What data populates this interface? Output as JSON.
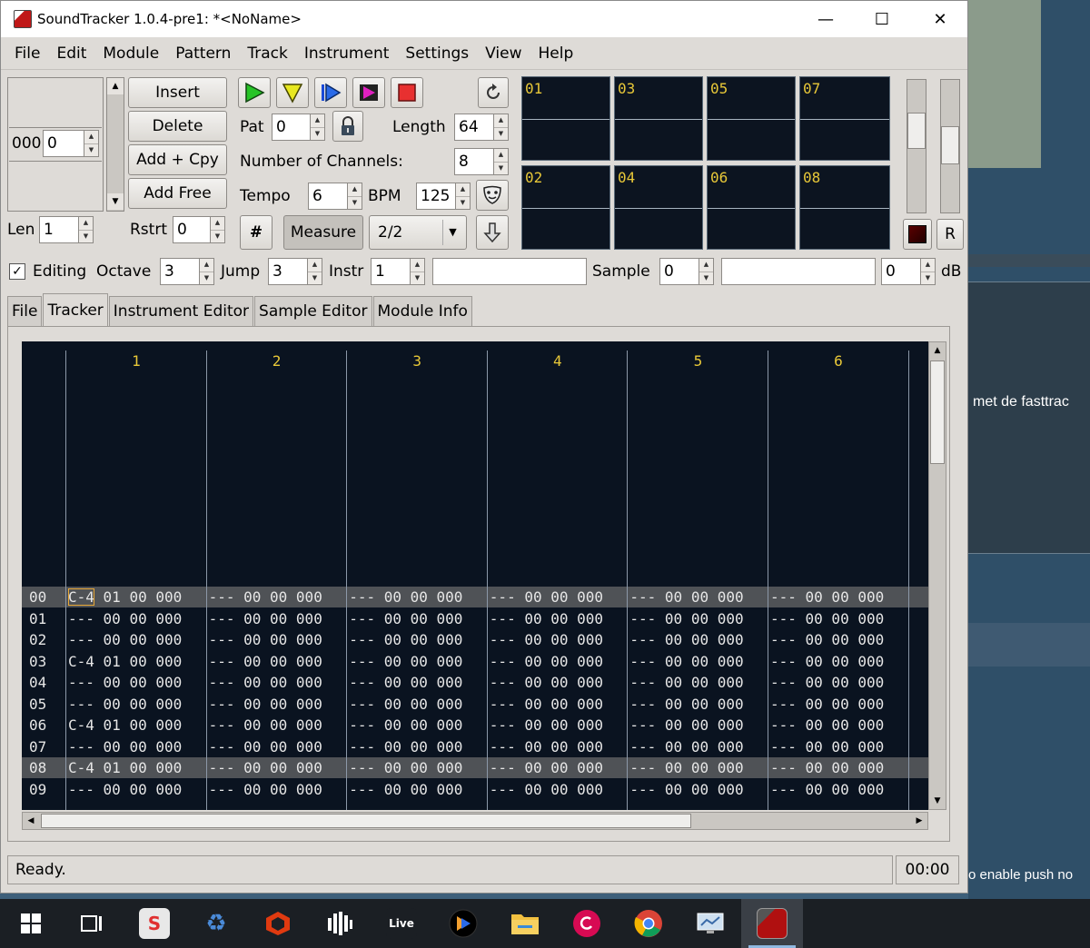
{
  "window": {
    "title": "SoundTracker 1.0.4-pre1: *<NoName>",
    "minimize": "—",
    "maximize": "☐",
    "close": "✕"
  },
  "menu": [
    "File",
    "Edit",
    "Module",
    "Pattern",
    "Track",
    "Instrument",
    "Settings",
    "View",
    "Help"
  ],
  "order": {
    "pos_label": "000",
    "pos_value": "0",
    "len_label": "Len",
    "len_value": "1",
    "rstrt_label": "Rstrt",
    "rstrt_value": "0"
  },
  "order_buttons": {
    "insert": "Insert",
    "delete": "Delete",
    "add_copy": "Add + Cpy",
    "add_free": "Add Free"
  },
  "pattern": {
    "pat_label": "Pat",
    "pat_value": "0",
    "length_label": "Length",
    "length_value": "64",
    "channels_label": "Number of Channels:",
    "channels_value": "8",
    "tempo_label": "Tempo",
    "tempo_value": "6",
    "bpm_label": "BPM",
    "bpm_value": "125",
    "hash_label": "#",
    "measure_label": "Measure",
    "measure_value": "2/2"
  },
  "scopes": [
    "01",
    "03",
    "05",
    "07",
    "02",
    "04",
    "06",
    "08"
  ],
  "vol": {
    "r_label": "R"
  },
  "editbar": {
    "editing_label": "Editing",
    "octave_label": "Octave",
    "octave_value": "3",
    "jump_label": "Jump",
    "jump_value": "3",
    "instr_label": "Instr",
    "instr_value": "1",
    "sample_label": "Sample",
    "sample_value": "0",
    "db_value": "0",
    "db_label": "dB"
  },
  "tabs": [
    "File",
    "Tracker",
    "Instrument Editor",
    "Sample Editor",
    "Module Info"
  ],
  "tracker": {
    "channels": [
      "1",
      "2",
      "3",
      "4",
      "5",
      "6"
    ],
    "rows": [
      {
        "num": "00",
        "c1": "C-4 01 00 000"
      },
      {
        "num": "01",
        "c1": "--- 00 00 000"
      },
      {
        "num": "02",
        "c1": "--- 00 00 000"
      },
      {
        "num": "03",
        "c1": "C-4 01 00 000"
      },
      {
        "num": "04",
        "c1": "--- 00 00 000"
      },
      {
        "num": "05",
        "c1": "--- 00 00 000"
      },
      {
        "num": "06",
        "c1": "C-4 01 00 000"
      },
      {
        "num": "07",
        "c1": "--- 00 00 000"
      },
      {
        "num": "08",
        "c1": "C-4 01 00 000"
      },
      {
        "num": "09",
        "c1": "--- 00 00 000"
      }
    ],
    "empty_cell": "--- 00 00 000"
  },
  "status": {
    "text": "Ready.",
    "time": "00:00"
  },
  "background": {
    "text1": "met de fasttrac",
    "text2": "o enable push no"
  },
  "taskbar": [
    "windows-start",
    "task-view",
    "s-app",
    "recycle-app",
    "red-cube-app",
    "bars-app",
    "live-app",
    "tidal-app",
    "file-explorer",
    "debian-app",
    "chrome",
    "remote-desktop",
    "soundtracker"
  ]
}
